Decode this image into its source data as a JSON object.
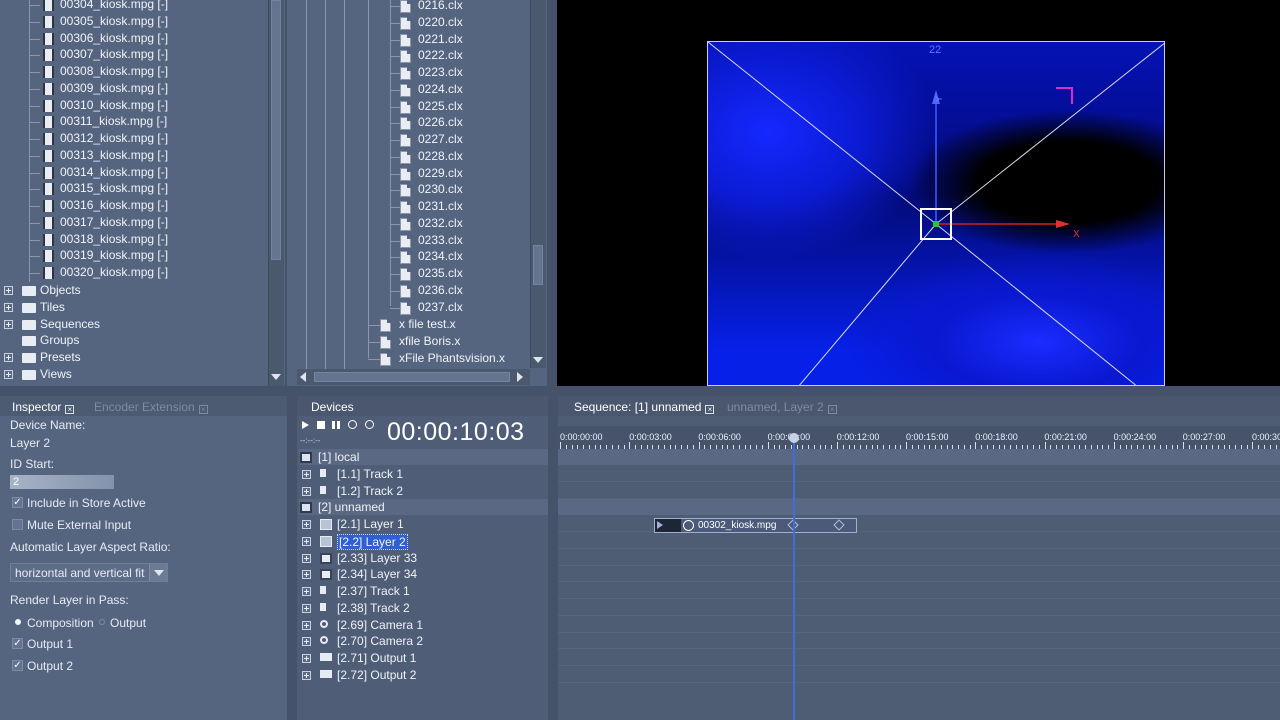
{
  "clips_list": [
    "00304_kiosk.mpg [-]",
    "00305_kiosk.mpg [-]",
    "00306_kiosk.mpg [-]",
    "00307_kiosk.mpg [-]",
    "00308_kiosk.mpg [-]",
    "00309_kiosk.mpg [-]",
    "00310_kiosk.mpg [-]",
    "00311_kiosk.mpg [-]",
    "00312_kiosk.mpg [-]",
    "00313_kiosk.mpg [-]",
    "00314_kiosk.mpg [-]",
    "00315_kiosk.mpg [-]",
    "00316_kiosk.mpg [-]",
    "00317_kiosk.mpg [-]",
    "00318_kiosk.mpg [-]",
    "00319_kiosk.mpg [-]",
    "00320_kiosk.mpg [-]"
  ],
  "project_categories": [
    "Objects",
    "Tiles",
    "Sequences",
    "Groups",
    "Presets",
    "Views"
  ],
  "file_list": [
    "0216.clx",
    "0220.clx",
    "0221.clx",
    "0222.clx",
    "0223.clx",
    "0224.clx",
    "0225.clx",
    "0226.clx",
    "0227.clx",
    "0228.clx",
    "0229.clx",
    "0230.clx",
    "0231.clx",
    "0232.clx",
    "0233.clx",
    "0234.clx",
    "0235.clx",
    "0236.clx",
    "0237.clx"
  ],
  "xfiles": [
    "x file test.x",
    "xfile Boris.x",
    "xFile Phantsvision.x"
  ],
  "viewport": {
    "label_top": "22",
    "axis_x": "X",
    "axis_y": "Y"
  },
  "inspector": {
    "tab_inspector": "Inspector",
    "tab_encoder": "Encoder Extension",
    "device_name_label": "Device Name:",
    "device_name_value": "Layer 2",
    "id_start_label": "ID Start:",
    "id_start_value": "2",
    "include_store": "Include in Store Active",
    "mute_input": "Mute External Input",
    "aspect_label": "Automatic Layer Aspect Ratio:",
    "aspect_value": "horizontal and vertical fit",
    "render_label": "Render Layer in Pass:",
    "opt_composition": "Composition",
    "opt_output": "Output",
    "output1": "Output 1",
    "output2": "Output 2"
  },
  "devices": {
    "tab": "Devices",
    "timecode": "00:00:10:03",
    "small_time": "--:--:--",
    "rows": [
      {
        "label": "[1] local"
      },
      {
        "label": "[1.1] Track 1"
      },
      {
        "label": "[1.2] Track 2"
      },
      {
        "label": "[2] unnamed"
      },
      {
        "label": "[2.1] Layer 1"
      },
      {
        "label": "[2.2] Layer 2"
      },
      {
        "label": "[2.33] Layer 33"
      },
      {
        "label": "[2.34] Layer 34"
      },
      {
        "label": "[2.37] Track 1"
      },
      {
        "label": "[2.38] Track 2"
      },
      {
        "label": "[2.69] Camera 1"
      },
      {
        "label": "[2.70] Camera 2"
      },
      {
        "label": "[2.71] Output 1"
      },
      {
        "label": "[2.72] Output 2"
      }
    ]
  },
  "sequence": {
    "tab_active": "Sequence: [1] unnamed",
    "tab_inactive": "unnamed, Layer 2",
    "ruler": [
      "0:00:00:00",
      "0:00:03:00",
      "0:00:06:00",
      "0:00:09:00",
      "0:00:12:00",
      "0:00:15:00",
      "0:00:18:00",
      "0:00:21:00",
      "0:00:24:00",
      "0:00:27:00",
      "0:00:30"
    ],
    "clip_label": "00302_kiosk.mpg"
  },
  "colors": {
    "accent_blue": "#0a1fff",
    "selection": "#2f5fd0",
    "playhead": "#3b6fe0"
  }
}
